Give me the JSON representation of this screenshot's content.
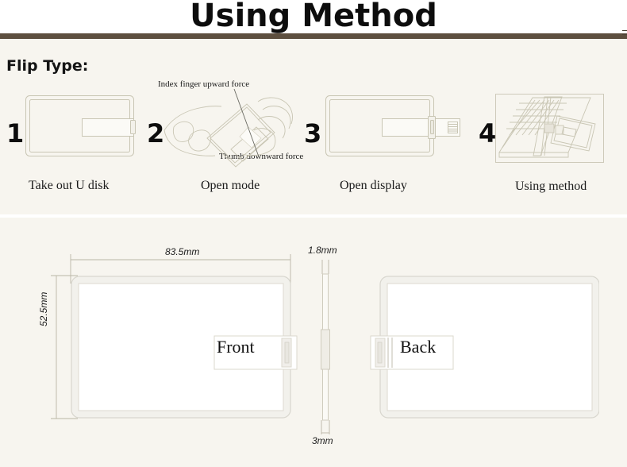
{
  "header": {
    "title": "Using Method",
    "rule_color": "#5d4f3f"
  },
  "steps_section": {
    "heading": "Flip Type:",
    "background": "#f7f5ef",
    "steps": [
      {
        "number": "1",
        "caption": "Take out U disk",
        "art": "card-closed-usb-inside"
      },
      {
        "number": "2",
        "caption": "Open mode",
        "art": "hand-holding-card-tilted",
        "annotations": [
          "Index finger upward force",
          "Thumb downward force"
        ]
      },
      {
        "number": "3",
        "caption": "Open display",
        "art": "card-usb-extended"
      },
      {
        "number": "4",
        "caption": "Using method",
        "art": "laptop-with-card-inserted"
      }
    ]
  },
  "dimensions_section": {
    "background": "#f7f5ef",
    "front_card": {
      "label": "Front",
      "width_dim": "83.5mm",
      "height_dim": "52.5mm"
    },
    "side_view": {
      "top_dim": "1.8mm",
      "bottom_dim": "3mm"
    },
    "back_card": {
      "label": "Back"
    }
  },
  "colors": {
    "page_background": "#ffffff",
    "panel_background": "#f7f5ef",
    "brown_rule": "#5d4f3f",
    "line_art": "#c9c6b4",
    "card_outline": "#d8d6ce",
    "card_fill": "#ffffff",
    "text": "#111111"
  }
}
